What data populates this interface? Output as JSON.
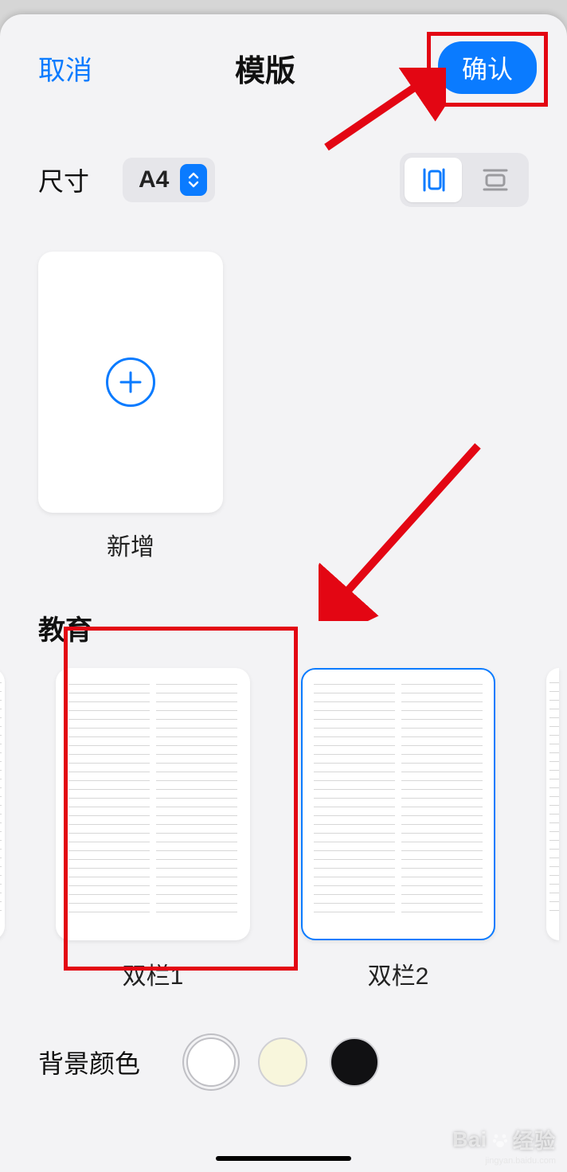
{
  "header": {
    "cancel": "取消",
    "title": "模版",
    "confirm": "确认"
  },
  "size": {
    "label": "尺寸",
    "value": "A4"
  },
  "orientation": {
    "portrait_selected": true
  },
  "newadd": {
    "label": "新增"
  },
  "section": {
    "education": "教育"
  },
  "templates": {
    "t1": {
      "label": "双栏1",
      "highlighted": true
    },
    "t2": {
      "label": "双栏2",
      "selected": true
    }
  },
  "background": {
    "label": "背景颜色",
    "colors": {
      "white": "#ffffff",
      "cream": "#f8f6dc",
      "black": "#111113"
    },
    "selected": "white"
  },
  "watermark": {
    "brand": "Bai",
    "brand2": "经验",
    "sub": "jingyan.baidu.com"
  }
}
